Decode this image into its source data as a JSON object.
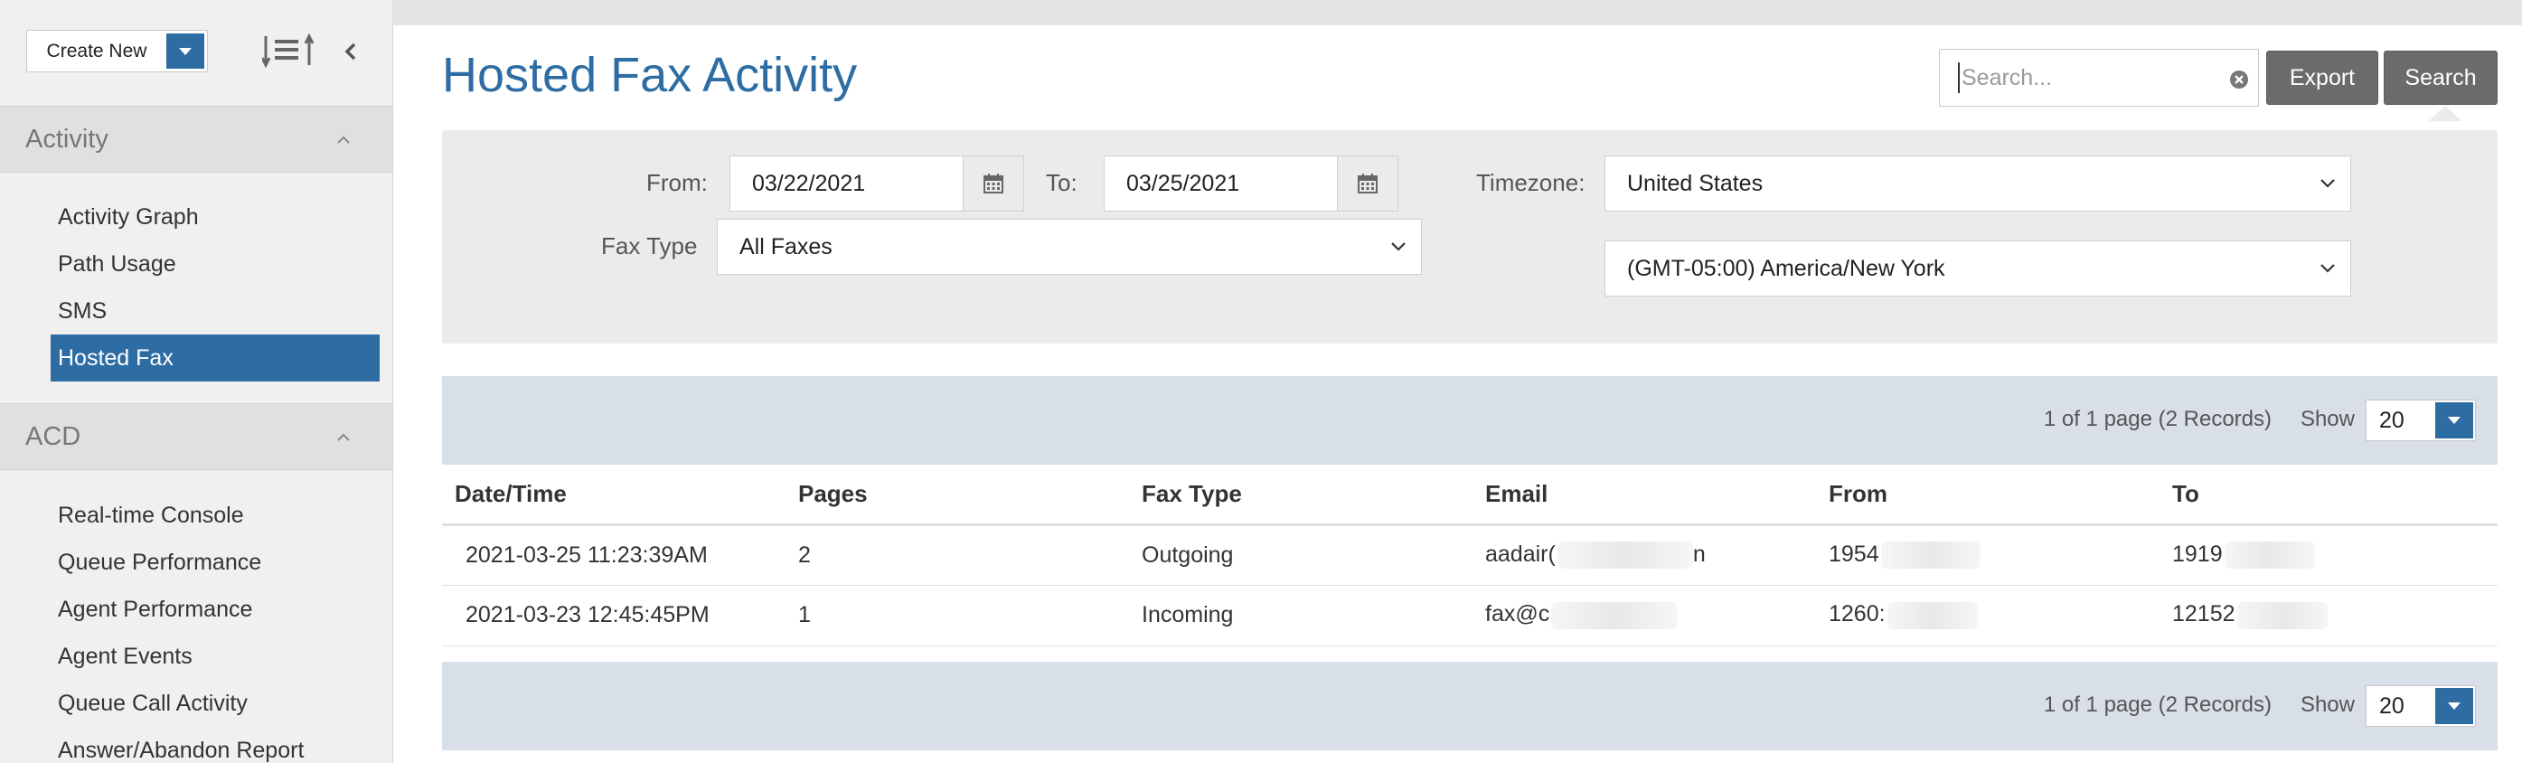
{
  "sidebar": {
    "create_new_label": "Create New",
    "sections": [
      {
        "title": "Activity",
        "items": [
          {
            "label": "Activity Graph"
          },
          {
            "label": "Path Usage"
          },
          {
            "label": "SMS"
          },
          {
            "label": "Hosted Fax",
            "active": true
          }
        ]
      },
      {
        "title": "ACD",
        "items": [
          {
            "label": "Real-time Console"
          },
          {
            "label": "Queue Performance"
          },
          {
            "label": "Agent Performance"
          },
          {
            "label": "Agent Events"
          },
          {
            "label": "Queue Call Activity"
          },
          {
            "label": "Answer/Abandon Report"
          }
        ]
      }
    ],
    "icons": [
      "sort-icon",
      "chevron-left-icon",
      "chevron-up-icon",
      "caret-down-icon"
    ]
  },
  "header": {
    "title": "Hosted Fax Activity",
    "search_placeholder": "Search...",
    "search_value": "",
    "export_label": "Export",
    "search_label": "Search"
  },
  "filters": {
    "from_label": "From:",
    "from_value": "03/22/2021",
    "to_label": "To:",
    "to_value": "03/25/2021",
    "timezone_label": "Timezone:",
    "timezone_region": "United States",
    "timezone_zone": "(GMT-05:00) America/New York",
    "fax_type_label": "Fax Type",
    "fax_type_value": "All Faxes"
  },
  "pager": {
    "info": "1 of 1 page (2 Records)",
    "show_label": "Show",
    "show_value": "20"
  },
  "table": {
    "columns": [
      "Date/Time",
      "Pages",
      "Fax Type",
      "Email",
      "From",
      "To"
    ],
    "rows": [
      {
        "datetime": "2021-03-25 11:23:39AM",
        "pages": "2",
        "fax_type": "Outgoing",
        "email": "aadair(",
        "email_tail": "n",
        "from": "1954",
        "to": "1919"
      },
      {
        "datetime": "2021-03-23 12:45:45PM",
        "pages": "1",
        "fax_type": "Incoming",
        "email": "fax@c",
        "email_tail": "",
        "from": "1260:",
        "to": "12152"
      }
    ]
  },
  "colors": {
    "accent": "#2e6da4",
    "button_dark": "#6b6b6b",
    "pager_bg": "#d8dfe8",
    "panel_bg": "#ebebeb"
  }
}
